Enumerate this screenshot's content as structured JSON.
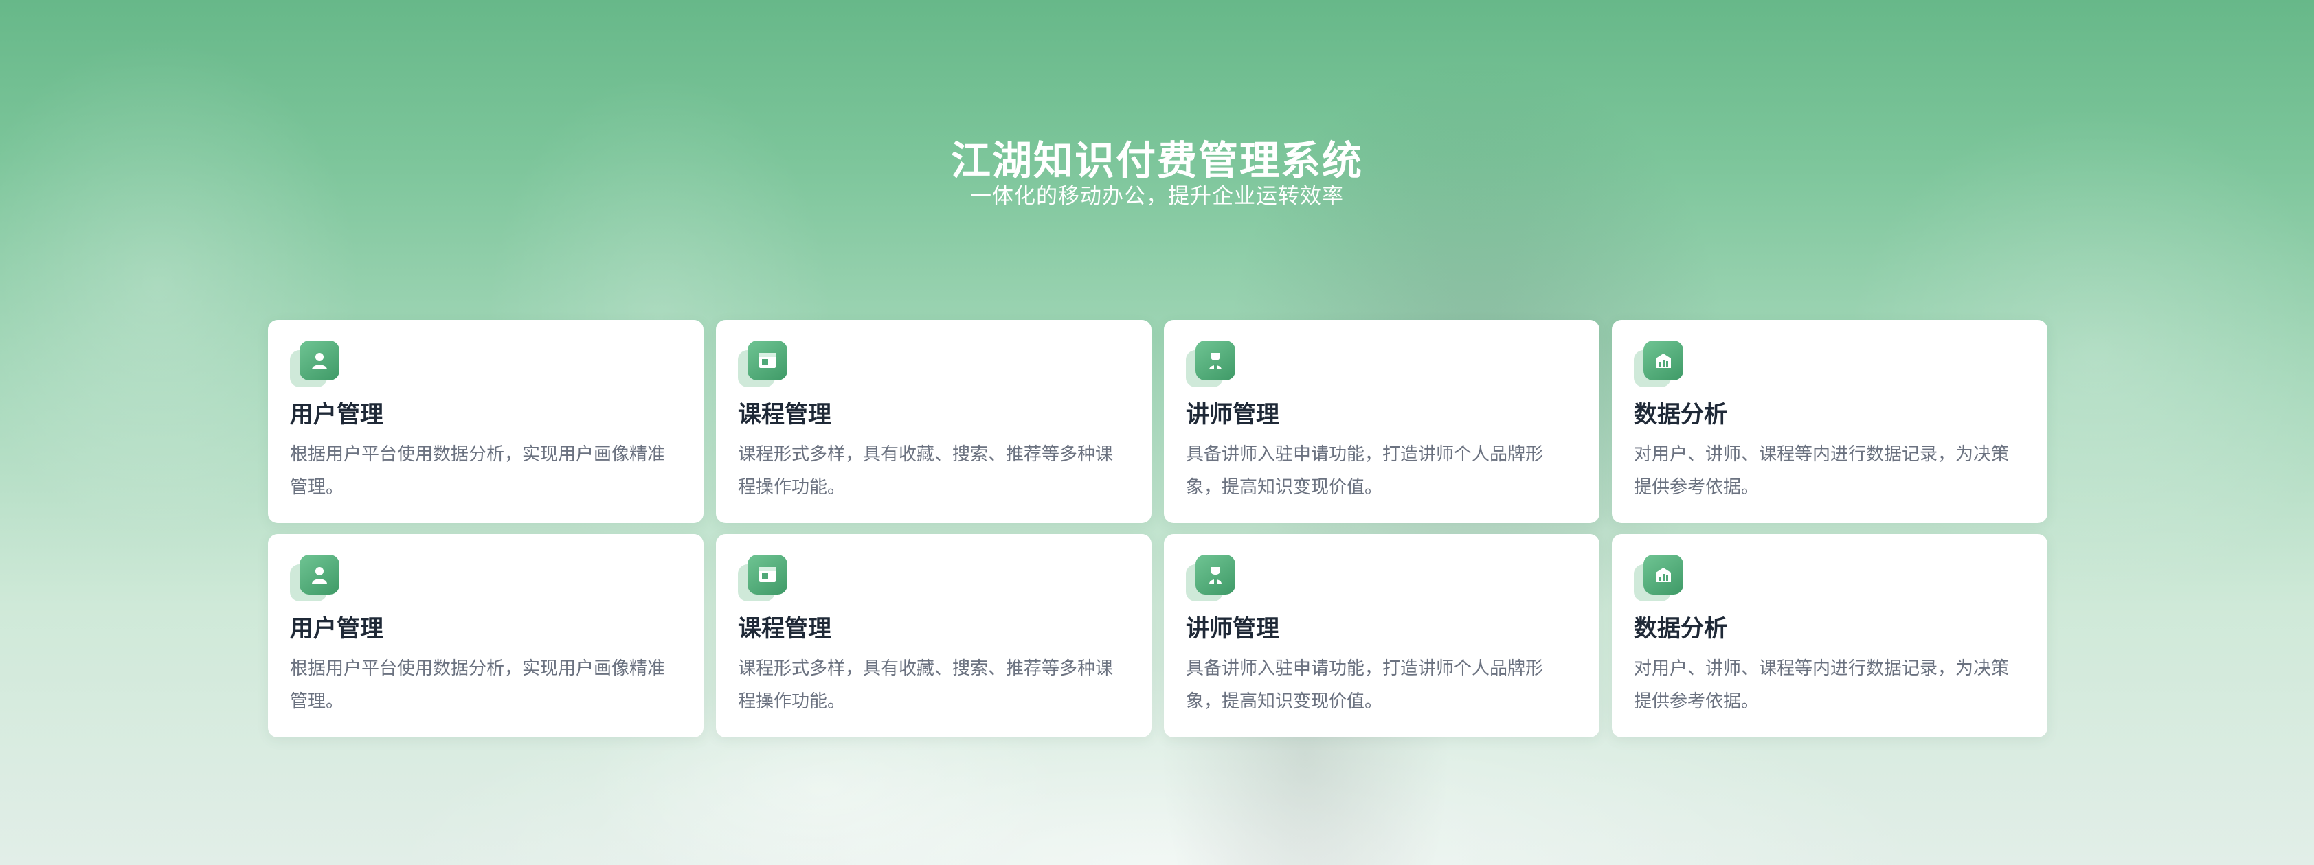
{
  "hero": {
    "title": "江湖知识付费管理系统",
    "subtitle": "一体化的移动办公，提升企业运转效率"
  },
  "colors": {
    "accent": "#4fa877",
    "icon_light": "#cfe9d9",
    "title_text": "#1f2937",
    "desc_text": "#6b7280"
  },
  "cards": [
    {
      "title": "用户管理",
      "desc": "根据用户平台使用数据分析，实现用户画像精准管理。",
      "icon": "user-icon"
    },
    {
      "title": "课程管理",
      "desc": "课程形式多样，具有收藏、搜索、推荐等多种课程操作功能。",
      "icon": "course-icon"
    },
    {
      "title": "讲师管理",
      "desc": "具备讲师入驻申请功能，打造讲师个人品牌形象，提高知识变现价值。",
      "icon": "teacher-icon"
    },
    {
      "title": "数据分析",
      "desc": "对用户、讲师、课程等内进行数据记录，为决策提供参考依据。",
      "icon": "data-chart-icon"
    },
    {
      "title": "用户管理",
      "desc": "根据用户平台使用数据分析，实现用户画像精准管理。",
      "icon": "user-icon"
    },
    {
      "title": "课程管理",
      "desc": "课程形式多样，具有收藏、搜索、推荐等多种课程操作功能。",
      "icon": "course-icon"
    },
    {
      "title": "讲师管理",
      "desc": "具备讲师入驻申请功能，打造讲师个人品牌形象，提高知识变现价值。",
      "icon": "teacher-icon"
    },
    {
      "title": "数据分析",
      "desc": "对用户、讲师、课程等内进行数据记录，为决策提供参考依据。",
      "icon": "data-chart-icon"
    }
  ]
}
